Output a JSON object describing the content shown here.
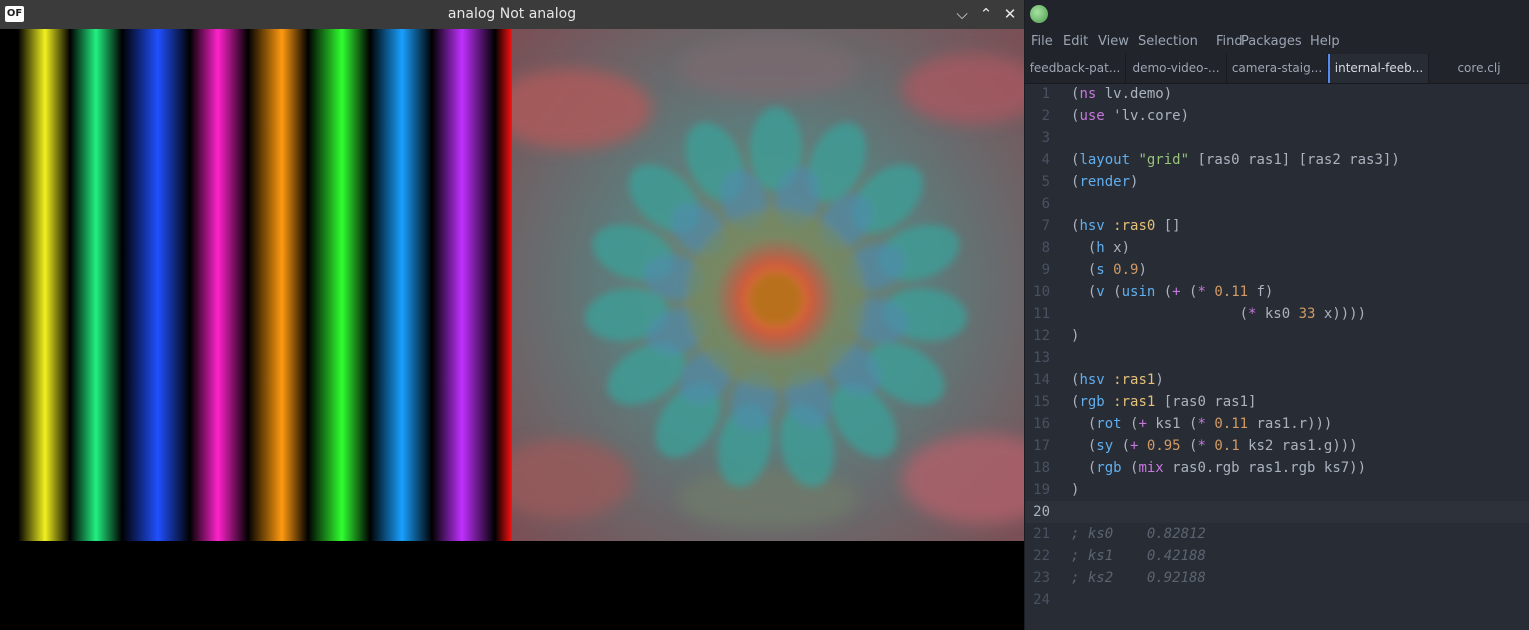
{
  "of_window": {
    "logo": "OF",
    "title": "analog Not analog",
    "controls": {
      "minimize": "⌵",
      "maximize": "⌃",
      "close": "✕"
    }
  },
  "editor": {
    "menu": [
      "File",
      "Edit",
      "View",
      "Selection",
      "Find",
      "Packages",
      "Help"
    ],
    "tabs": [
      {
        "label": "feedback-pat...",
        "active": false
      },
      {
        "label": "demo-video-...",
        "active": false
      },
      {
        "label": "camera-staig...",
        "active": false
      },
      {
        "label": "internal-feeb...",
        "active": true
      },
      {
        "label": "core.clj",
        "active": false
      }
    ],
    "line_numbers": [
      "1",
      "2",
      "3",
      "4",
      "5",
      "6",
      "7",
      "8",
      "9",
      "10",
      "11",
      "12",
      "13",
      "14",
      "15",
      "16",
      "17",
      "18",
      "19",
      "20",
      "21",
      "22",
      "23",
      "24"
    ],
    "cursor_line": 20,
    "code": {
      "l1": [
        "(",
        "ns",
        " lv.demo)"
      ],
      "l2": [
        "(",
        "use",
        " 'lv.core)"
      ],
      "l4": [
        "(",
        "layout",
        " ",
        "\"grid\"",
        " [ras0 ras1] [ras2 ras3])"
      ],
      "l5": [
        "(",
        "render",
        ")"
      ],
      "l7": [
        "(",
        "hsv",
        " ",
        ":ras0",
        " []"
      ],
      "l8": [
        "  (",
        "h",
        " x)"
      ],
      "l9": [
        "  (",
        "s",
        " ",
        "0.9",
        ")"
      ],
      "l10": [
        "  (",
        "v",
        " (",
        "usin",
        " (",
        "+",
        " (",
        "*",
        " ",
        "0.11",
        " f)"
      ],
      "l11": [
        "                    (",
        "*",
        " ks0 ",
        "33",
        " x))))"
      ],
      "l12": [
        ")"
      ],
      "l14": [
        "(",
        "hsv",
        " ",
        ":ras1",
        ")"
      ],
      "l15": [
        "(",
        "rgb",
        " ",
        ":ras1",
        " [ras0 ras1]"
      ],
      "l16": [
        "  (",
        "rot",
        " (",
        "+",
        " ks1 (",
        "*",
        " ",
        "0.11",
        " ras1.r)))"
      ],
      "l17": [
        "  (",
        "sy",
        " (",
        "+",
        " ",
        "0.95",
        " (",
        "*",
        " ",
        "0.1",
        " ks2 ras1.g)))"
      ],
      "l18": [
        "  (",
        "rgb",
        " (",
        "mix",
        " ras0.rgb ras1.rgb ks7))"
      ],
      "l19": [
        ")"
      ],
      "l21": "; ks0    0.82812",
      "l22": "; ks1    0.42188",
      "l23": "; ks2    0.92188"
    }
  }
}
